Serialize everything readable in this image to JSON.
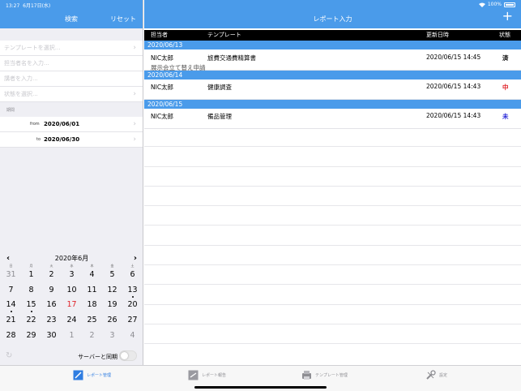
{
  "status_bar": {
    "time": "13:27",
    "date": "6月17日(水)",
    "battery": "100%"
  },
  "left_panel": {
    "title": "検索",
    "reset_label": "リセット",
    "filters": [
      {
        "placeholder": "テンプレートを選択..."
      },
      {
        "placeholder": "担当者名を入力..."
      },
      {
        "placeholder": "講者を入力..."
      },
      {
        "placeholder": "状態を選択..."
      }
    ],
    "period_label": "期間",
    "from_label": "from",
    "from_value": "2020/06/01",
    "to_label": "to",
    "to_value": "2020/06/30"
  },
  "calendar": {
    "month_title": "2020年6月",
    "weekdays": [
      "日",
      "月",
      "火",
      "水",
      "木",
      "金",
      "土"
    ],
    "weeks": [
      [
        "31",
        "1",
        "2",
        "3",
        "4",
        "5",
        "6"
      ],
      [
        "7",
        "8",
        "9",
        "10",
        "11",
        "12",
        "13"
      ],
      [
        "14",
        "15",
        "16",
        "17",
        "18",
        "19",
        "20"
      ],
      [
        "21",
        "22",
        "23",
        "24",
        "25",
        "26",
        "27"
      ],
      [
        "28",
        "29",
        "30",
        "1",
        "2",
        "3",
        "4"
      ]
    ]
  },
  "sync": {
    "label": "サーバーと同期"
  },
  "right_panel": {
    "title": "レポート入力",
    "add_label": "+",
    "columns": {
      "owner": "担当者",
      "template": "テンプレート",
      "updated": "更新日時",
      "status": "状態"
    },
    "groups": [
      {
        "date": "2020/06/13",
        "rows": [
          {
            "owner": "NIC太郎",
            "template": "旅費交通費精算書",
            "subtitle": "展示会立て替え申請",
            "updated": "2020/06/15 14:45",
            "status": "済",
            "status_color": "#000000"
          }
        ]
      },
      {
        "date": "2020/06/14",
        "rows": [
          {
            "owner": "NIC太郎",
            "template": "健康調査",
            "subtitle": "",
            "updated": "2020/06/15 14:43",
            "status": "中",
            "status_color": "#e0242a"
          }
        ]
      },
      {
        "date": "2020/06/15",
        "rows": [
          {
            "owner": "NIC太郎",
            "template": "備品管理",
            "subtitle": "",
            "updated": "2020/06/15 14:43",
            "status": "未",
            "status_color": "#2a2ad8"
          }
        ]
      }
    ]
  },
  "tab_bar": {
    "tabs": [
      {
        "label": "レポート管理",
        "icon": "report-edit-icon"
      },
      {
        "label": "レポート報告",
        "icon": "report-send-icon"
      },
      {
        "label": "テンプレート管理",
        "icon": "template-printer-icon"
      },
      {
        "label": "設定",
        "icon": "wrench-icon"
      }
    ]
  },
  "colors": {
    "accent": "#4a9bea",
    "active_tab": "#2f7de1",
    "today": "#e0242a"
  }
}
